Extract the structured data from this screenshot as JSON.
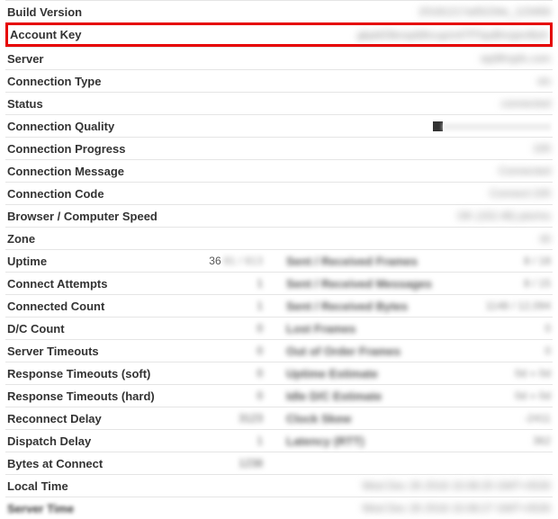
{
  "rows_full": [
    {
      "label": "Build Version",
      "value": "20181217a05234e_123456",
      "highlight": false
    },
    {
      "label": "Account Key",
      "value": "gkpb03knxpfdhcupm47fThpdfmzjen9izh",
      "highlight": true
    },
    {
      "label": "Server",
      "value": "wp9fropfx.com",
      "highlight": false
    },
    {
      "label": "Connection Type",
      "value": "ws",
      "highlight": false
    },
    {
      "label": "Status",
      "value": "connected",
      "highlight": false
    },
    {
      "label": "Connection Quality",
      "value": "",
      "highlight": false,
      "quality": true
    },
    {
      "label": "Connection Progress",
      "value": "100",
      "highlight": false
    },
    {
      "label": "Connection Message",
      "value": "Connected",
      "highlight": false
    },
    {
      "label": "Connection Code",
      "value": "Connect:100",
      "highlight": false
    },
    {
      "label": "Browser / Computer Speed",
      "value": "OK (152.46) pts/ms",
      "highlight": false
    },
    {
      "label": "Zone",
      "value": "sb",
      "highlight": false
    }
  ],
  "rows_split": [
    {
      "left_label": "Uptime",
      "left_value": "36",
      "left_extra": "81 / 813",
      "right_label": "Sent / Received Frames",
      "right_value": "8 / 18"
    },
    {
      "left_label": "Connect Attempts",
      "left_value": "1",
      "left_extra": "",
      "right_label": "Sent / Received Messages",
      "right_value": "8 / 15"
    },
    {
      "left_label": "Connected Count",
      "left_value": "1",
      "left_extra": "",
      "right_label": "Sent / Received Bytes",
      "right_value": "1148 / 12,094"
    },
    {
      "left_label": "D/C Count",
      "left_value": "0",
      "left_extra": "",
      "right_label": "Lost Frames",
      "right_value": "0"
    },
    {
      "left_label": "Server Timeouts",
      "left_value": "0",
      "left_extra": "",
      "right_label": "Out of Order Frames",
      "right_value": "0"
    },
    {
      "left_label": "Response Timeouts (soft)",
      "left_value": "0",
      "left_extra": "",
      "right_label": "Uptime Estimate",
      "right_value": "0d » 0d"
    },
    {
      "left_label": "Response Timeouts (hard)",
      "left_value": "0",
      "left_extra": "",
      "right_label": "Idle D/C Estimate",
      "right_value": "0d » 0d"
    },
    {
      "left_label": "Reconnect Delay",
      "left_value": "3123",
      "left_extra": "",
      "right_label": "Clock Skew",
      "right_value": "-2411"
    },
    {
      "left_label": "Dispatch Delay",
      "left_value": "1",
      "left_extra": "",
      "right_label": "Latency (RTT)",
      "right_value": "362"
    },
    {
      "left_label": "Bytes at Connect",
      "left_value": "1238",
      "left_extra": "",
      "right_label": "",
      "right_value": ""
    }
  ],
  "local_time": {
    "label": "Local Time",
    "value": "Wed Dec 26 2018 15:08:25 GMT+0530"
  },
  "server_time": {
    "label": "Server Time",
    "value": "Wed Dec 26 2018 15:08:27 GMT+0530"
  }
}
